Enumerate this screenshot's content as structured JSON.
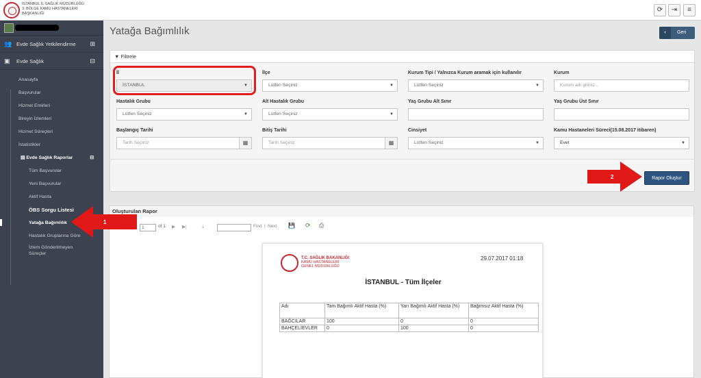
{
  "header": {
    "org_line1": "İSTANBUL İL SAĞLIK MÜDÜRLÜĞÜ",
    "org_line2": "3. BÖLGE KAMU HASTANELERİ",
    "org_line3": "BAŞKANLIĞI",
    "icons": [
      "refresh-icon",
      "logout-icon",
      "menu-icon"
    ]
  },
  "sidebar": {
    "groups": [
      {
        "label": "Evde Sağlık Yetkilendirme",
        "toggle": "⊞"
      },
      {
        "label": "Evde Sağlık",
        "toggle": "⊟"
      }
    ],
    "items": [
      "Anasayfa",
      "Başvurular",
      "Hizmet Emirleri",
      "Bireyin İzlemleri",
      "Hizmet Süreçleri",
      "İstatistikler"
    ],
    "reports_label": "Evde Sağlık Raporlar",
    "report_items": [
      "Tüm Başvurular",
      "Yeni Başvurular",
      "Aktif Hasta",
      "ÖBS Sorgu Listesi",
      "Yatağa Bağımlılık",
      "Hastalık Gruplarına Göre",
      "İzlem Gönderilmeyen",
      "Süreçler"
    ]
  },
  "page": {
    "title": "Yatağa Bağımlılık",
    "back_label": "Geri"
  },
  "filter": {
    "heading": "Filtrele",
    "il_label": "İl",
    "il_value": "İSTANBUL",
    "ilce_label": "İlçe",
    "ilce_value": "Lütfen Seçiniz",
    "kurum_tipi_label": "Kurum Tipi / Yalnızca Kurum aramak için kullanılır",
    "kurum_tipi_value": "Lütfen Seçiniz",
    "kurum_label": "Kurum",
    "kurum_placeholder": "Kurum adı giriniz...",
    "hastalik_label": "Hastalık Grubu",
    "hastalik_value": "Lütfen Seçiniz",
    "alt_hastalik_label": "Alt Hastalık Grubu",
    "alt_hastalik_value": "Lütfen Seçiniz",
    "yas_alt_label": "Yaş Grubu Alt Sınır",
    "yas_ust_label": "Yaş Grubu Üst Sınır",
    "baslangic_label": "Başlangıç Tarihi",
    "baslangic_placeholder": "Tarih Seçiniz",
    "bitis_label": "Bitiş Tarihi",
    "bitis_placeholder": "Tarih Seçiniz",
    "cinsiyet_label": "Cinsiyet",
    "cinsiyet_value": "Lütfen Seçiniz",
    "kamu_label": "Kamu Hastaneleri Süreci",
    "kamu_note": "(15.08.2017 itibaren)",
    "kamu_value": "Evet",
    "report_button": "Rapor Oluştur"
  },
  "annotations": {
    "step1": "1",
    "step2": "2"
  },
  "report": {
    "heading": "Oluşturulan Rapor",
    "page_value": "1",
    "page_of": "of 1",
    "find_label": "Find",
    "next_label": "Next",
    "logo_line1": "T.C. SAĞLIK BAKANLIĞI",
    "logo_line2": "KAMU HASTANELERİ",
    "logo_line3": "GENEL MÜDÜRLÜĞÜ",
    "date": "29.07.2017 01:18",
    "title": "İSTANBUL - Tüm İlçeler",
    "columns": [
      "Adı",
      "Tam Bağımlı Aktif Hasta (%)",
      "Yarı Bağımlı Aktif Hasta (%)",
      "Bağımsız Aktif Hasta (%)"
    ],
    "rows": [
      [
        "BAĞCILAR",
        "100",
        "0",
        "0"
      ],
      [
        "BAHÇELİEVLER",
        "0",
        "100",
        "0"
      ]
    ]
  }
}
